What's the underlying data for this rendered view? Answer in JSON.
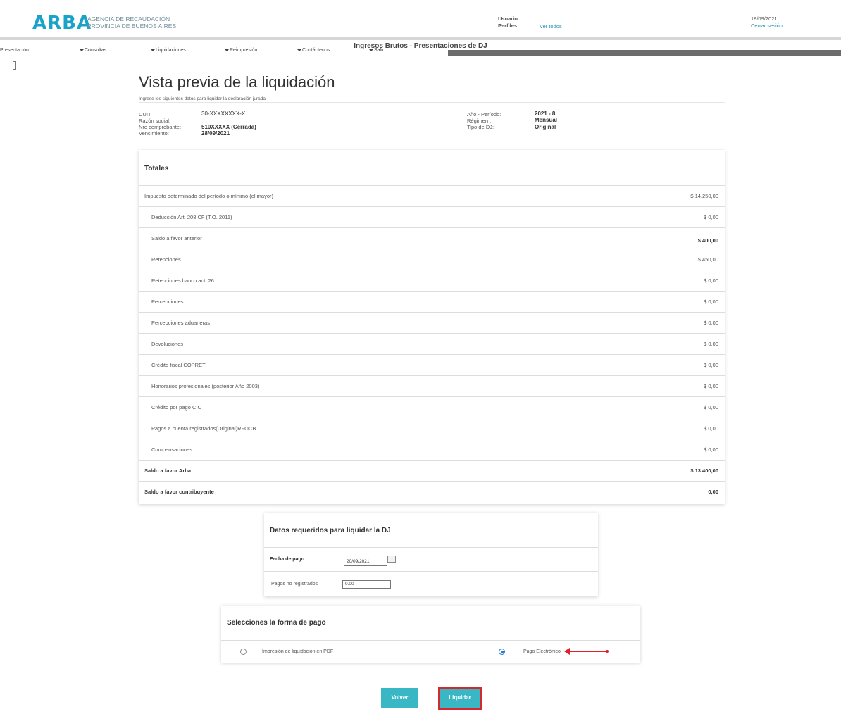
{
  "header": {
    "logo": "ARBA",
    "agency_line1": "AGENCIA DE RECAUDACIÓN",
    "agency_line2": "PROVINCIA DE BUENOS AIRES",
    "usuario_label": "Usuario:",
    "perfiles_label": "Perfiles:",
    "ver_todos": "Ver todos",
    "date": "18/09/2021",
    "logout": "Cerrar sesión",
    "app_name": "Ingresos Brutos - Presentaciones de DJ"
  },
  "menu": [
    "Presentación",
    "Consultas",
    "Liquidaciones",
    "Reimpresión",
    "Contáctenos",
    "Salir"
  ],
  "page": {
    "title": "Vista previa de la liquidación",
    "subtitle": "Ingrese los siguientes datos para liquidar la declaración jurada"
  },
  "info": {
    "cuit_label": "CUIT:",
    "cuit": "30-XXXXXXXX-X",
    "razon_label": "Razón social:",
    "razon": "",
    "comprobante_label": "Nro comprobante:",
    "comprobante": "510XXXXX (Cerrada)",
    "vencimiento_label": "Vencimiento:",
    "vencimiento": "28/09/2021",
    "periodo_label": "Año - Período:",
    "periodo": "2021 - 8",
    "regimen_label": "Régimen :",
    "regimen": "Mensual",
    "tipo_label": "Tipo de DJ:",
    "tipo": "Original"
  },
  "totales": {
    "title": "Totales",
    "rows": [
      {
        "label": "Impuesto determinado del período o mínimo (el mayor)",
        "value": "$ 14.250,00"
      },
      {
        "label": "Deducción Art. 208 CF (T.O. 2011)",
        "value": "$ 0,00"
      },
      {
        "label": "Saldo a favor anterior",
        "value": "$ 400,00"
      },
      {
        "label": "Retenciones",
        "value": "$ 450,00"
      },
      {
        "label": "Retenciones banco act. 26",
        "value": "$ 0,00"
      },
      {
        "label": "Percepciones",
        "value": "$ 0,00"
      },
      {
        "label": "Percepciones aduaneras",
        "value": "$ 0,00"
      },
      {
        "label": "Devoluciones",
        "value": "$ 0,00"
      },
      {
        "label": "Crédito fiscal COPRET",
        "value": "$ 0,00"
      },
      {
        "label": "Honorarios profesionales (posterior Año 2003)",
        "value": "$ 0,00"
      },
      {
        "label": "Crédito por pago CIC",
        "value": "$ 0,00"
      },
      {
        "label": "Pagos a cuenta registrados(Original)RFOCB",
        "value": "$ 0,00"
      },
      {
        "label": "Compensaciones",
        "value": "$ 0,00"
      },
      {
        "label": "Saldo a favor Arba",
        "value": "$ 13.400,00"
      },
      {
        "label": "Saldo a favor contribuyente",
        "value": "0,00"
      }
    ]
  },
  "datos": {
    "title": "Datos requeridos para liquidar la DJ",
    "fecha_label": "Fecha de pago",
    "fecha_value": "20/09/2021",
    "pagos_label": "Pagos no registrados",
    "pagos_value": "0.00"
  },
  "forma": {
    "title": "Selecciones la forma de pago",
    "option_pdf": "Impresión de liquidación en PDF",
    "option_electronico": "Pago Electrónico",
    "selected": "Pago Electrónico",
    "arrow_color": "#e0202a"
  },
  "buttons": {
    "volver": "Volver",
    "liquidar": "Liquidar"
  }
}
